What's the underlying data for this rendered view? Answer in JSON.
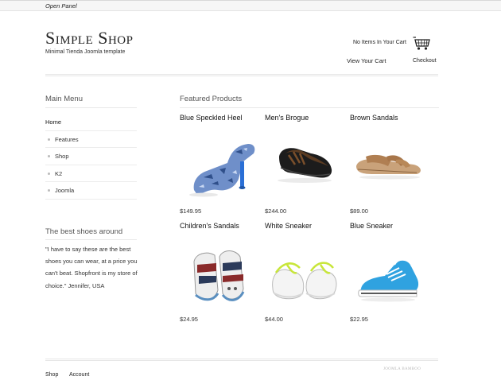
{
  "topbar": {
    "open_panel": "Open Panel"
  },
  "site": {
    "title": "Simple Shop",
    "tagline": "Minimal Tienda Joomla template"
  },
  "cart": {
    "status": "No Items In Your Cart",
    "view_cart": "View Your Cart",
    "checkout": "Checkout",
    "icon": "basket-icon"
  },
  "main_menu": {
    "heading": "Main Menu",
    "items": [
      {
        "label": "Home"
      },
      {
        "label": "Features"
      },
      {
        "label": "Shop"
      },
      {
        "label": "K2"
      },
      {
        "label": "Joomla"
      }
    ]
  },
  "testimonial": {
    "heading": "The best shoes around",
    "text": "\"I have to say these are the best shoes you can wear, at a price you can't beat. Shopfront is my store of choice.\" Jennifer, USA"
  },
  "featured": {
    "heading": "Featured Products",
    "products": [
      {
        "name": "Blue Speckled Heel",
        "price": "$149.95",
        "image": "blue-speckled-heel"
      },
      {
        "name": "Men's Brogue",
        "price": "$244.00",
        "image": "mens-brogue"
      },
      {
        "name": "Brown Sandals",
        "price": "$89.00",
        "image": "brown-sandals"
      },
      {
        "name": "Children's Sandals",
        "price": "$24.95",
        "image": "childrens-sandals"
      },
      {
        "name": "White Sneaker",
        "price": "$44.00",
        "image": "white-sneaker"
      },
      {
        "name": "Blue Sneaker",
        "price": "$22.95",
        "image": "blue-sneaker"
      }
    ]
  },
  "footer": {
    "links": [
      "Shop",
      "Account"
    ],
    "credit": "JOOMLA BAMBOO"
  }
}
